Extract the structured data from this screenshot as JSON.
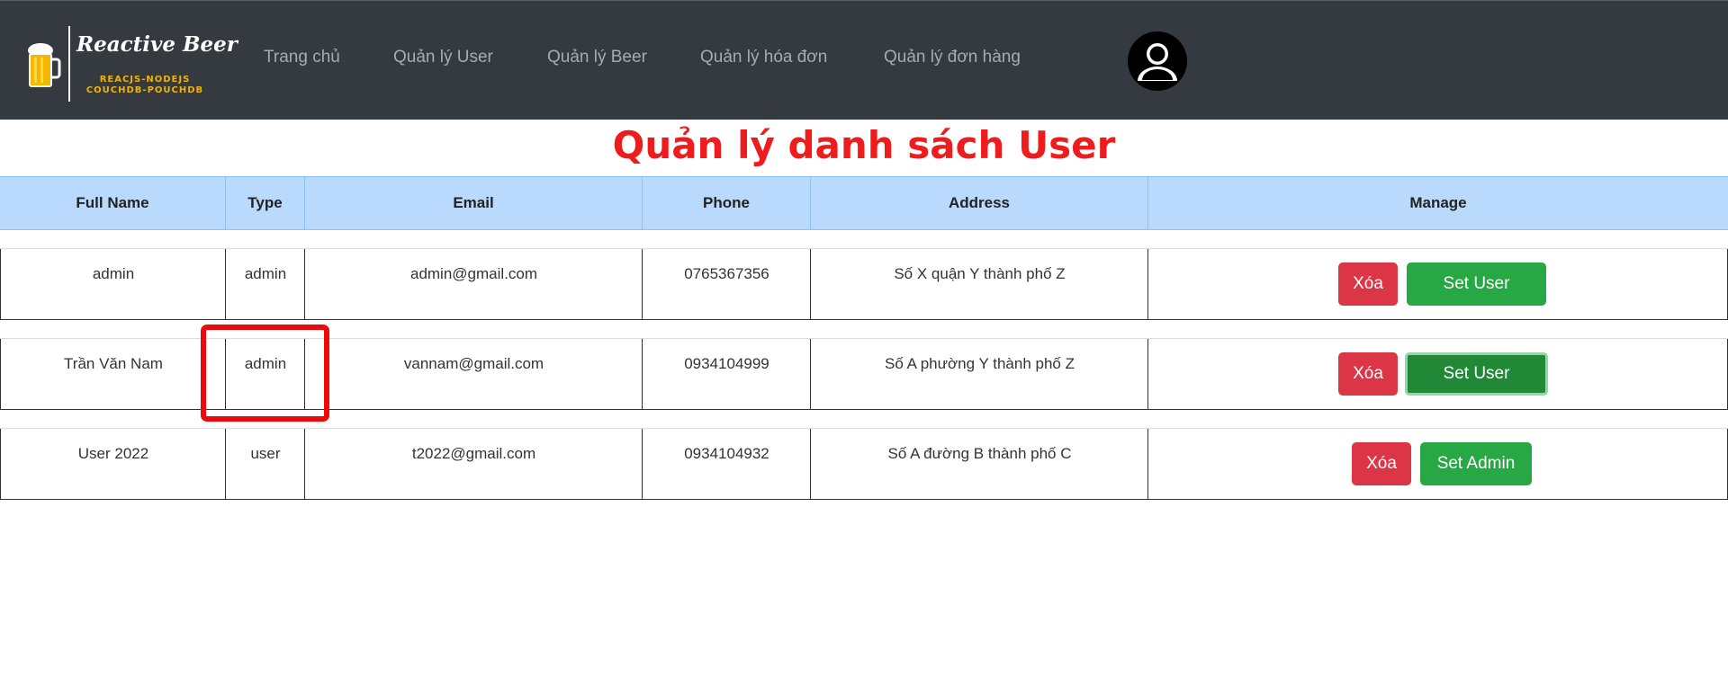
{
  "brand": {
    "title": "Reactive Beer",
    "subtitle_line1": "REACJS-NODEJS",
    "subtitle_line2": "COUCHDB-POUCHDB",
    "logo_icon": "beer-mug-icon"
  },
  "nav": {
    "items": [
      {
        "label": "Trang chủ"
      },
      {
        "label": "Quản lý User"
      },
      {
        "label": "Quản lý Beer"
      },
      {
        "label": "Quản lý hóa đơn"
      },
      {
        "label": "Quản lý đơn hàng"
      }
    ],
    "avatar_icon": "user-avatar-icon"
  },
  "page": {
    "title": "Quản lý danh sách User"
  },
  "table": {
    "headers": [
      "Full Name",
      "Type",
      "Email",
      "Phone",
      "Address",
      "Manage"
    ],
    "rows": [
      {
        "full_name": "admin",
        "type": "admin",
        "email": "admin@gmail.com",
        "phone": "0765367356",
        "address": "Số X quận Y thành phố Z",
        "delete_label": "Xóa",
        "role_label": "Set User"
      },
      {
        "full_name": "Trần Văn Nam",
        "type": "admin",
        "email": "vannam@gmail.com",
        "phone": "0934104999",
        "address": "Số A phường Y thành phố Z",
        "delete_label": "Xóa",
        "role_label": "Set User"
      },
      {
        "full_name": "User 2022",
        "type": "user",
        "email": "t2022@gmail.com",
        "phone": "0934104932",
        "address": "Số A đường B thành phố C",
        "delete_label": "Xóa",
        "role_label": "Set Admin"
      }
    ]
  },
  "colors": {
    "navbar": "#343a40",
    "title_red": "#ee1c1c",
    "header_blue": "#b9dafd",
    "danger": "#dc3545",
    "success": "#28a745",
    "highlight": "#ee0a0a"
  }
}
